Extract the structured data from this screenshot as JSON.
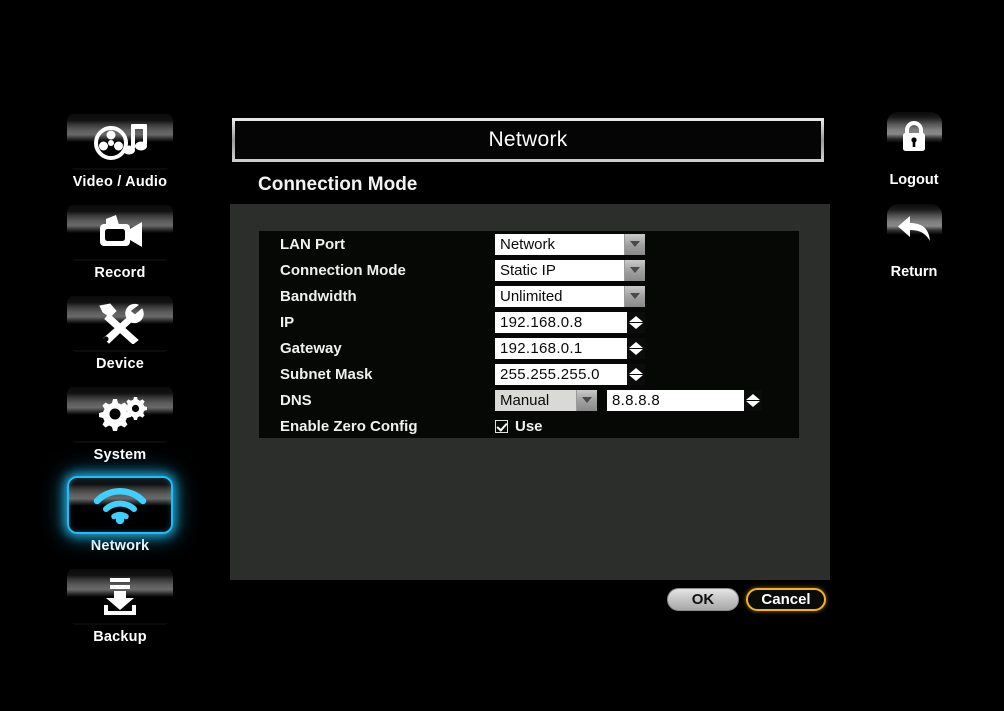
{
  "window": {
    "title": "Network",
    "section_heading": "Connection Mode"
  },
  "colors": {
    "accent_selected": "#22bdf5",
    "focus_ring": "#f5b21e",
    "panel_bg": "#2b2e2b",
    "form_bg": "#060806",
    "background": "#000000"
  },
  "left_sidebar": {
    "items": [
      {
        "label": "Video / Audio",
        "icon": "film-music-icon",
        "selected": false
      },
      {
        "label": "Record",
        "icon": "camcorder-icon",
        "selected": false
      },
      {
        "label": "Device",
        "icon": "hammer-wrench-icon",
        "selected": false
      },
      {
        "label": "System",
        "icon": "gears-icon",
        "selected": false
      },
      {
        "label": "Network",
        "icon": "wifi-icon",
        "selected": true
      },
      {
        "label": "Backup",
        "icon": "download-tray-icon",
        "selected": false
      }
    ]
  },
  "right_sidebar": {
    "items": [
      {
        "label": "Logout",
        "icon": "lock-icon"
      },
      {
        "label": "Return",
        "icon": "back-arrow-icon"
      }
    ]
  },
  "form": {
    "rows": [
      {
        "label": "LAN Port",
        "type": "dropdown",
        "value": "Network"
      },
      {
        "label": "Connection Mode",
        "type": "dropdown",
        "value": "Static IP"
      },
      {
        "label": "Bandwidth",
        "type": "dropdown",
        "value": "Unlimited"
      },
      {
        "label": "IP",
        "type": "spinner",
        "value": "192.168.0.8"
      },
      {
        "label": "Gateway",
        "type": "spinner",
        "value": "192.168.0.1"
      },
      {
        "label": "Subnet Mask",
        "type": "spinner",
        "value": "255.255.255.0"
      },
      {
        "label": "DNS",
        "type": "dns",
        "mode": "Manual",
        "value": "8.8.8.8"
      },
      {
        "label": "Enable Zero Config",
        "type": "checkbox",
        "value": "Use",
        "checked": true
      }
    ]
  },
  "buttons": {
    "ok_label": "OK",
    "cancel_label": "Cancel"
  }
}
